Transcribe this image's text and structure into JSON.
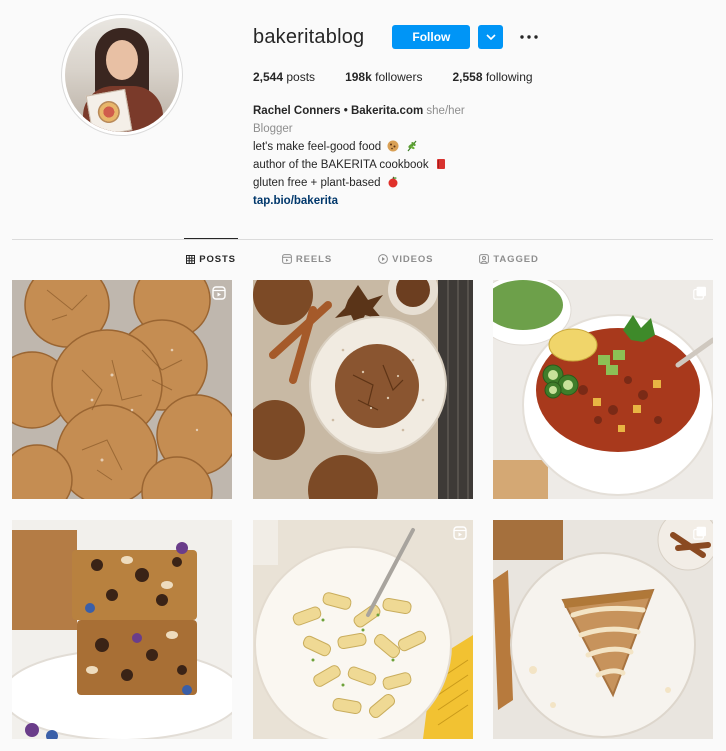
{
  "profile": {
    "username": "bakeritablog",
    "follow_label": "Follow",
    "posts_count": "2,544",
    "posts_label": "posts",
    "followers_count": "198k",
    "followers_label": "followers",
    "following_count": "2,558",
    "following_label": "following",
    "full_name": "Rachel Conners • Bakerita.com",
    "pronouns": "she/her",
    "category": "Blogger",
    "bio_lines": [
      "let's make feel-good food",
      "author of the BAKERITA cookbook",
      "gluten free + plant-based"
    ],
    "link": "tap.bio/bakerita"
  },
  "tabs": [
    {
      "label": "POSTS",
      "icon": "grid-icon",
      "active": true
    },
    {
      "label": "REELS",
      "icon": "reels-icon",
      "active": false
    },
    {
      "label": "VIDEOS",
      "icon": "play-circle-icon",
      "active": false
    },
    {
      "label": "TAGGED",
      "icon": "tag-icon",
      "active": false
    }
  ],
  "posts": [
    {
      "subject": "ginger molasses cookies",
      "badge": "reel-icon"
    },
    {
      "subject": "sugared cookie on plate with cinnamon",
      "badge": ""
    },
    {
      "subject": "chili bowl with jalapeño and avocado",
      "badge": "carousel-icon"
    },
    {
      "subject": "stacked chocolate blondie bars",
      "badge": ""
    },
    {
      "subject": "rigatoni pasta in creamy sauce",
      "badge": "reel-icon"
    },
    {
      "subject": "spiced cake slice with glaze",
      "badge": "carousel-icon"
    }
  ],
  "colors": {
    "accent": "#0095f6",
    "link": "#00376b",
    "muted": "#8e8e8e",
    "text": "#262626"
  }
}
